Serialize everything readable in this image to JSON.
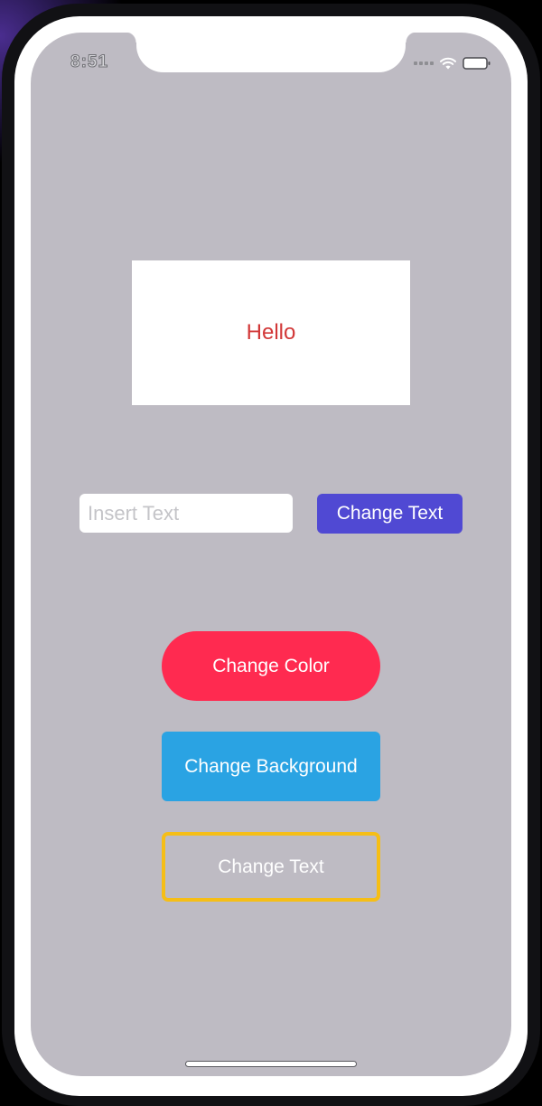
{
  "status_bar": {
    "time": "8:51",
    "icons": [
      "signal-dots-icon",
      "wifi-icon",
      "battery-icon"
    ]
  },
  "label": {
    "text": "Hello",
    "text_color": "#d23838",
    "background": "#ffffff"
  },
  "input": {
    "value": "",
    "placeholder": "Insert Text"
  },
  "buttons": {
    "change_text_top": {
      "label": "Change Text",
      "color": "#5049d3"
    },
    "change_color": {
      "label": "Change Color",
      "color": "#ff2a50"
    },
    "change_background": {
      "label": "Change Background",
      "color": "#2aa3e3"
    },
    "change_text_outline": {
      "label": "Change Text",
      "border_color": "#f6be16"
    }
  },
  "colors": {
    "screen_background": "#bebbc3"
  }
}
